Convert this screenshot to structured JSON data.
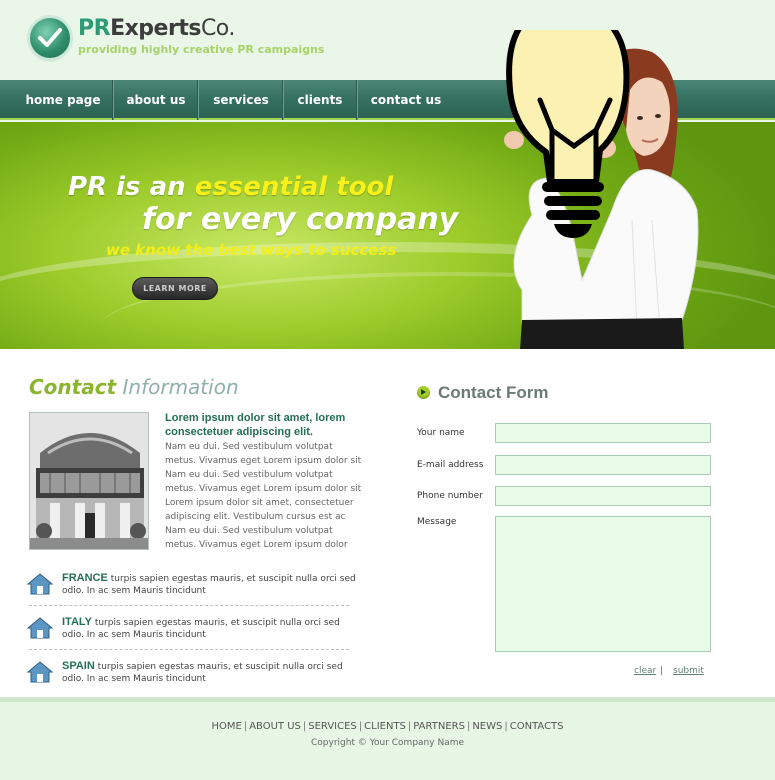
{
  "brand": {
    "name_pr": "PR",
    "name_experts": "Experts",
    "name_co": "Co.",
    "tagline": "providing highly creative PR campaigns",
    "logo_icon": "checkmark-icon"
  },
  "nav": {
    "items": [
      {
        "label": "home page"
      },
      {
        "label": "about us"
      },
      {
        "label": "services"
      },
      {
        "label": "clients"
      },
      {
        "label": "contact us"
      }
    ]
  },
  "hero": {
    "line1_prefix": "PR is an ",
    "line1_highlight": "essential tool",
    "line2": "for every company",
    "line3": "we know the best ways to success",
    "button_label": "LEARN MORE"
  },
  "contact_info": {
    "title_a": "Contact",
    "title_b": " Information",
    "intro_heading": "Lorem ipsum dolor sit amet, lorem consectetuer adipiscing elit.",
    "intro_body": "Nam eu dui. Sed vestibulum volutpat metus. Vivamus eget Lorem ipsum dolor sit Nam eu dui. Sed vestibulum volutpat metus. Vivamus eget Lorem ipsum dolor sit Lorem ipsum dolor sit amet, consectetuer adipiscing elit. Vestibulum cursus est ac Nam eu dui. Sed vestibulum volutpat metus. Vivamus eget Lorem ipsum dolor",
    "locations": [
      {
        "name": "FRANCE",
        "text": " turpis sapien egestas mauris, et suscipit nulla orci sed odio. In ac sem Mauris tincidunt"
      },
      {
        "name": "ITALY",
        "text": " turpis sapien egestas mauris, et suscipit nulla orci sed odio. In ac sem Mauris tincidunt"
      },
      {
        "name": "SPAIN",
        "text": " turpis sapien egestas mauris, et suscipit nulla orci sed odio. In ac sem Mauris tincidunt"
      }
    ]
  },
  "contact_form": {
    "title": "Contact Form",
    "name_label": "Your name",
    "email_label": "E-mail address",
    "phone_label": "Phone number",
    "message_label": "Message",
    "name_value": "",
    "email_value": "",
    "phone_value": "",
    "message_value": "",
    "clear_label": "clear",
    "separator": "|",
    "submit_label": "submit"
  },
  "footer": {
    "links": [
      "HOME",
      "ABOUT US",
      "SERVICES",
      "CLIENTS",
      "PARTNERS",
      "NEWS",
      "CONTACTS"
    ],
    "copyright": "Copyright © Your Company Name"
  },
  "colors": {
    "brand_green": "#2f9a76",
    "nav_bg": "#35705f",
    "hero_green": "#9ccb2a",
    "highlight_yellow": "#f7f01a",
    "accent_lime": "#a6cf27"
  }
}
